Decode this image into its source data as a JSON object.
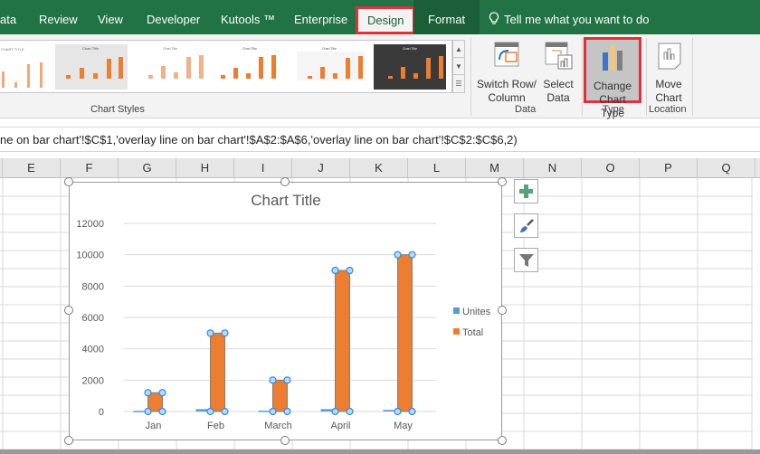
{
  "ribbon_tabs": [
    {
      "label": "ata"
    },
    {
      "label": "Review"
    },
    {
      "label": "View"
    },
    {
      "label": "Developer"
    },
    {
      "label": "Kutools ™"
    },
    {
      "label": "Enterprise"
    },
    {
      "label": "Design",
      "active": true
    },
    {
      "label": "Format"
    }
  ],
  "tell_me": "Tell me what you want to do",
  "chart_styles_label": "Chart Styles",
  "buttons": {
    "switch_row": [
      "Switch Row/",
      "Column"
    ],
    "select_data": [
      "Select",
      "Data"
    ],
    "change_type": [
      "Change",
      "Chart Type"
    ],
    "move_chart": [
      "Move",
      "Chart"
    ]
  },
  "groups": {
    "data": "Data",
    "type": "Type",
    "location": "Location"
  },
  "formula": "ne on bar chart'!$C$1,'overlay line on bar chart'!$A$2:$A$6,'overlay line on bar chart'!$C$2:$C$6,2)",
  "columns": [
    "E",
    "F",
    "G",
    "H",
    "I",
    "J",
    "K",
    "L",
    "M",
    "N",
    "O",
    "P",
    "Q"
  ],
  "colors": {
    "total": "#ed7d31",
    "unites": "#5b9bd5",
    "ribbon_green": "#217346",
    "highlight": "#e0313b"
  },
  "chart_data": {
    "type": "bar",
    "title": "Chart Title",
    "categories": [
      "Jan",
      "Feb",
      "March",
      "April",
      "May"
    ],
    "series": [
      {
        "name": "Unites",
        "values": [
          40,
          150,
          50,
          150,
          100
        ]
      },
      {
        "name": "Total",
        "values": [
          1200,
          5000,
          2000,
          9000,
          10000
        ]
      }
    ],
    "ylim": [
      0,
      12000
    ],
    "yticks": [
      0,
      2000,
      4000,
      6000,
      8000,
      10000,
      12000
    ],
    "grid": true,
    "legend": "right",
    "xlabel": "",
    "ylabel": ""
  }
}
